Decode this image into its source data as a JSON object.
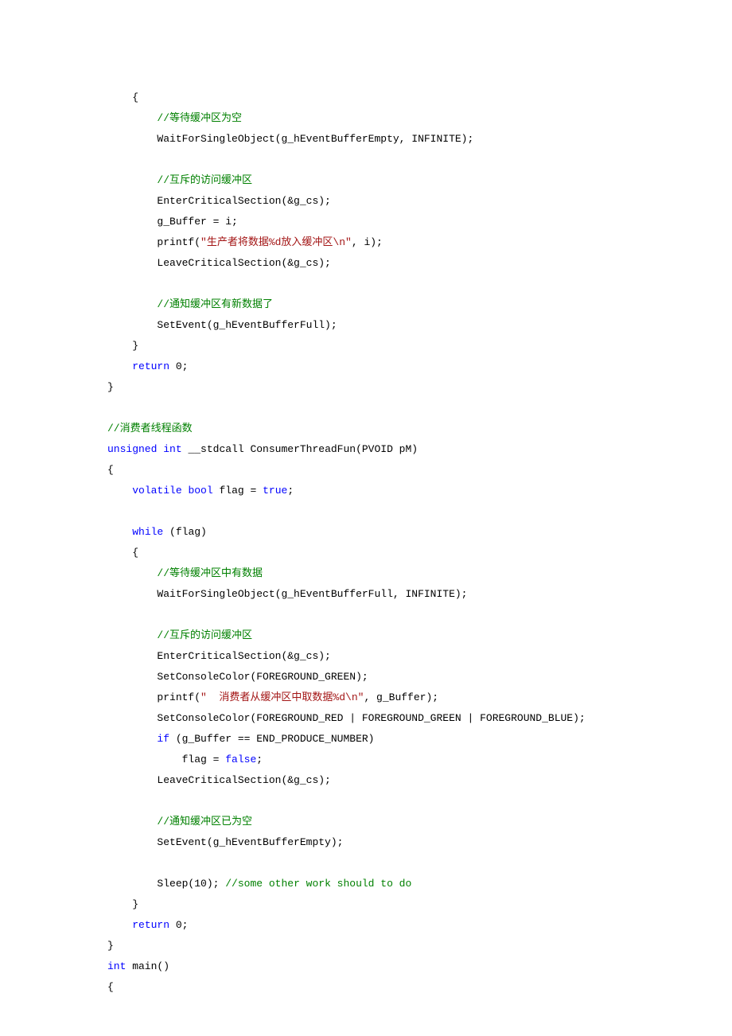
{
  "lines": [
    {
      "indent": 1,
      "segments": [
        {
          "t": "{",
          "c": ""
        }
      ]
    },
    {
      "indent": 2,
      "segments": [
        {
          "t": "//等待缓冲区为空",
          "c": "k-green"
        }
      ]
    },
    {
      "indent": 2,
      "segments": [
        {
          "t": "WaitForSingleObject(g_hEventBufferEmpty, INFINITE);",
          "c": ""
        }
      ]
    },
    {
      "indent": 0,
      "segments": [
        {
          "t": "",
          "c": ""
        }
      ]
    },
    {
      "indent": 2,
      "segments": [
        {
          "t": "//互斥的访问缓冲区",
          "c": "k-green"
        }
      ]
    },
    {
      "indent": 2,
      "segments": [
        {
          "t": "EnterCriticalSection(&g_cs);",
          "c": ""
        }
      ]
    },
    {
      "indent": 2,
      "segments": [
        {
          "t": "g_Buffer = i;",
          "c": ""
        }
      ]
    },
    {
      "indent": 2,
      "segments": [
        {
          "t": "printf(",
          "c": ""
        },
        {
          "t": "\"生产者将数据%d放入缓冲区\\n\"",
          "c": "k-red"
        },
        {
          "t": ", i);",
          "c": ""
        }
      ]
    },
    {
      "indent": 2,
      "segments": [
        {
          "t": "LeaveCriticalSection(&g_cs);",
          "c": ""
        }
      ]
    },
    {
      "indent": 0,
      "segments": [
        {
          "t": "",
          "c": ""
        }
      ]
    },
    {
      "indent": 2,
      "segments": [
        {
          "t": "//通知缓冲区有新数据了",
          "c": "k-green"
        }
      ]
    },
    {
      "indent": 2,
      "segments": [
        {
          "t": "SetEvent(g_hEventBufferFull);",
          "c": ""
        }
      ]
    },
    {
      "indent": 1,
      "segments": [
        {
          "t": "}",
          "c": ""
        }
      ]
    },
    {
      "indent": 1,
      "segments": [
        {
          "t": "return",
          "c": "k-blue"
        },
        {
          "t": " 0;",
          "c": ""
        }
      ]
    },
    {
      "indent": 0,
      "segments": [
        {
          "t": "}",
          "c": ""
        }
      ]
    },
    {
      "indent": 0,
      "segments": [
        {
          "t": "",
          "c": ""
        }
      ]
    },
    {
      "indent": 0,
      "segments": [
        {
          "t": "//消费者线程函数",
          "c": "k-green"
        }
      ]
    },
    {
      "indent": 0,
      "segments": [
        {
          "t": "unsigned",
          "c": "k-blue"
        },
        {
          "t": " ",
          "c": ""
        },
        {
          "t": "int",
          "c": "k-blue"
        },
        {
          "t": " __stdcall ConsumerThreadFun(PVOID pM)",
          "c": ""
        }
      ]
    },
    {
      "indent": 0,
      "segments": [
        {
          "t": "{",
          "c": ""
        }
      ]
    },
    {
      "indent": 1,
      "segments": [
        {
          "t": "volatile",
          "c": "k-blue"
        },
        {
          "t": " ",
          "c": ""
        },
        {
          "t": "bool",
          "c": "k-blue"
        },
        {
          "t": " flag = ",
          "c": ""
        },
        {
          "t": "true",
          "c": "k-blue"
        },
        {
          "t": ";",
          "c": ""
        }
      ]
    },
    {
      "indent": 0,
      "segments": [
        {
          "t": "",
          "c": ""
        }
      ]
    },
    {
      "indent": 1,
      "segments": [
        {
          "t": "while",
          "c": "k-blue"
        },
        {
          "t": " (flag)",
          "c": ""
        }
      ]
    },
    {
      "indent": 1,
      "segments": [
        {
          "t": "{",
          "c": ""
        }
      ]
    },
    {
      "indent": 2,
      "segments": [
        {
          "t": "//等待缓冲区中有数据",
          "c": "k-green"
        }
      ]
    },
    {
      "indent": 2,
      "segments": [
        {
          "t": "WaitForSingleObject(g_hEventBufferFull, INFINITE);",
          "c": ""
        }
      ]
    },
    {
      "indent": 0,
      "segments": [
        {
          "t": "",
          "c": ""
        }
      ]
    },
    {
      "indent": 2,
      "segments": [
        {
          "t": "//互斥的访问缓冲区",
          "c": "k-green"
        }
      ]
    },
    {
      "indent": 2,
      "segments": [
        {
          "t": "EnterCriticalSection(&g_cs);",
          "c": ""
        }
      ]
    },
    {
      "indent": 2,
      "segments": [
        {
          "t": "SetConsoleColor(FOREGROUND_GREEN);",
          "c": ""
        }
      ]
    },
    {
      "indent": 2,
      "segments": [
        {
          "t": "printf(",
          "c": ""
        },
        {
          "t": "\"  消费者从缓冲区中取数据%d\\n\"",
          "c": "k-red"
        },
        {
          "t": ", g_Buffer);",
          "c": ""
        }
      ]
    },
    {
      "indent": 2,
      "segments": [
        {
          "t": "SetConsoleColor(FOREGROUND_RED | FOREGROUND_GREEN | FOREGROUND_BLUE);",
          "c": ""
        }
      ]
    },
    {
      "indent": 2,
      "segments": [
        {
          "t": "if",
          "c": "k-blue"
        },
        {
          "t": " (g_Buffer == END_PRODUCE_NUMBER)",
          "c": ""
        }
      ]
    },
    {
      "indent": 3,
      "segments": [
        {
          "t": "flag = ",
          "c": ""
        },
        {
          "t": "false",
          "c": "k-blue"
        },
        {
          "t": ";",
          "c": ""
        }
      ]
    },
    {
      "indent": 2,
      "segments": [
        {
          "t": "LeaveCriticalSection(&g_cs);",
          "c": ""
        }
      ]
    },
    {
      "indent": 0,
      "segments": [
        {
          "t": "",
          "c": ""
        }
      ]
    },
    {
      "indent": 2,
      "segments": [
        {
          "t": "//通知缓冲区已为空",
          "c": "k-green"
        }
      ]
    },
    {
      "indent": 2,
      "segments": [
        {
          "t": "SetEvent(g_hEventBufferEmpty);",
          "c": ""
        }
      ]
    },
    {
      "indent": 0,
      "segments": [
        {
          "t": "",
          "c": ""
        }
      ]
    },
    {
      "indent": 2,
      "segments": [
        {
          "t": "Sleep(10); ",
          "c": ""
        },
        {
          "t": "//some other work should to do",
          "c": "k-green"
        }
      ]
    },
    {
      "indent": 1,
      "segments": [
        {
          "t": "}",
          "c": ""
        }
      ]
    },
    {
      "indent": 1,
      "segments": [
        {
          "t": "return",
          "c": "k-blue"
        },
        {
          "t": " 0;",
          "c": ""
        }
      ]
    },
    {
      "indent": 0,
      "segments": [
        {
          "t": "}",
          "c": ""
        }
      ]
    },
    {
      "indent": 0,
      "segments": [
        {
          "t": "int",
          "c": "k-blue"
        },
        {
          "t": " main()",
          "c": ""
        }
      ]
    },
    {
      "indent": 0,
      "segments": [
        {
          "t": "{",
          "c": ""
        }
      ]
    }
  ],
  "indent_unit": "    "
}
